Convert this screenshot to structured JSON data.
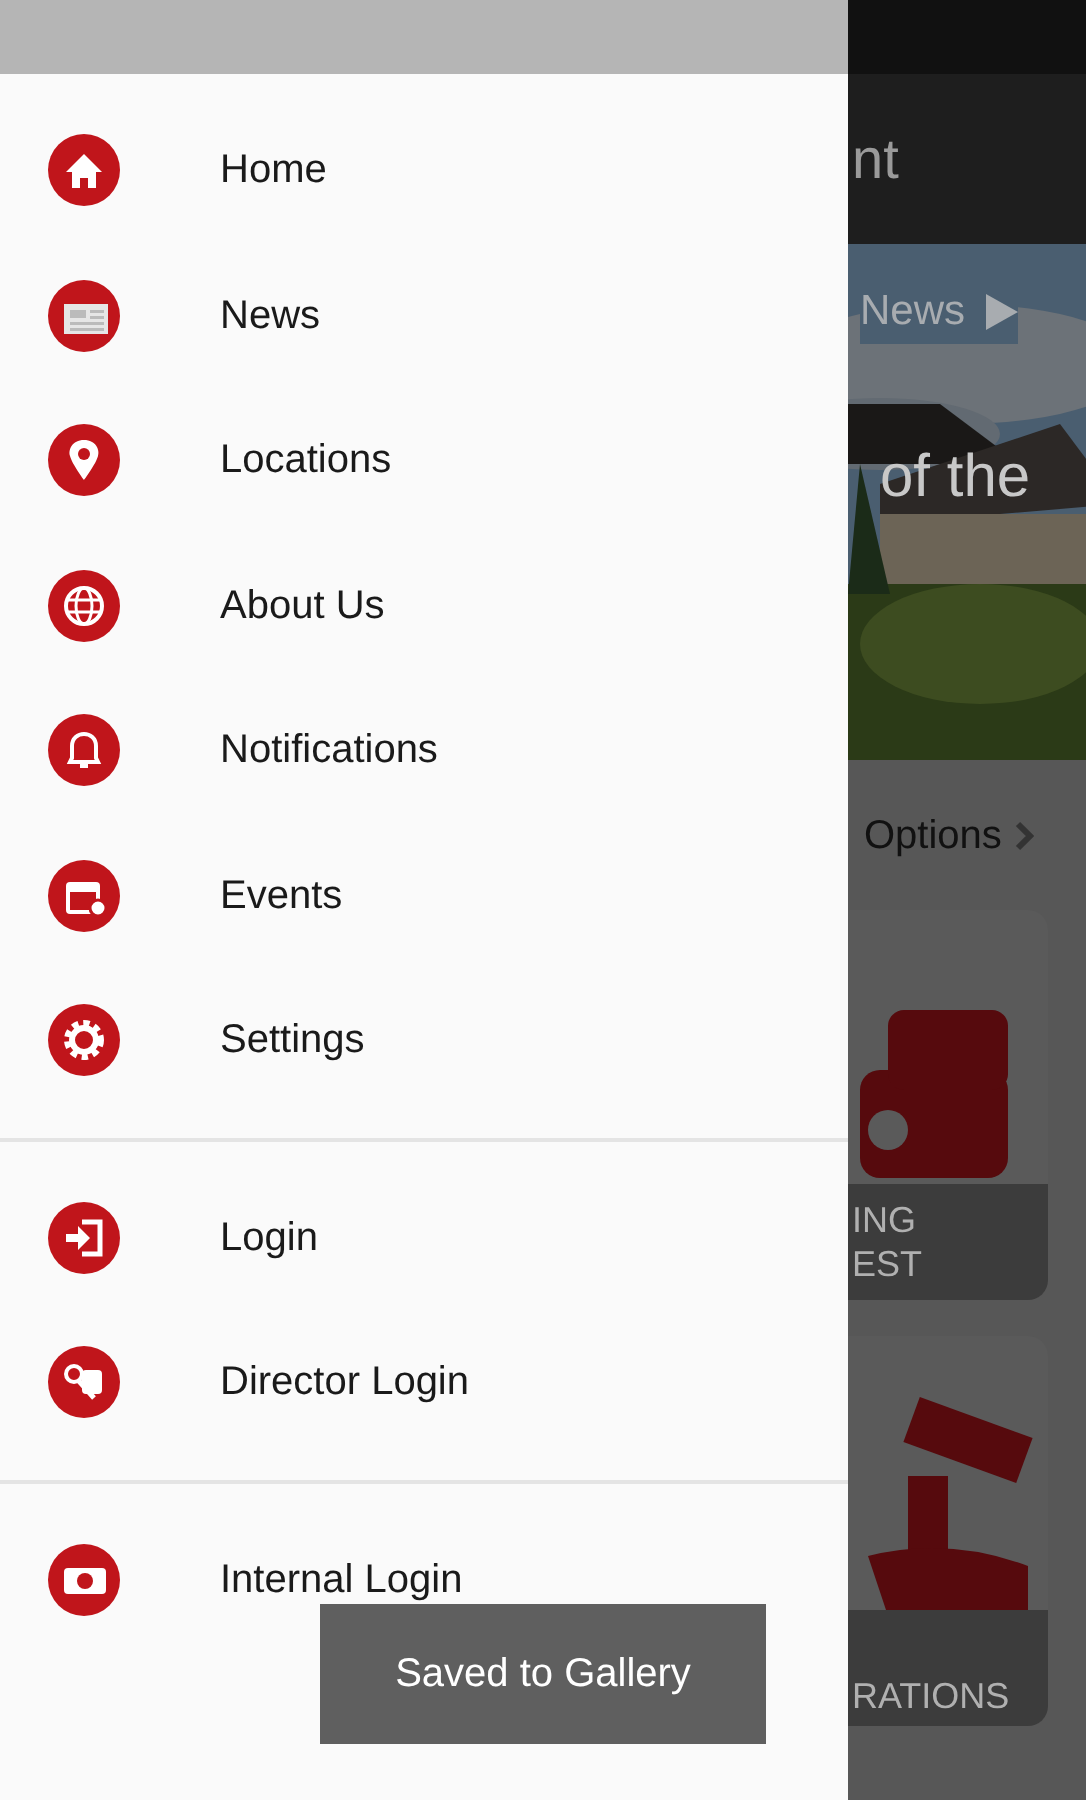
{
  "background_app": {
    "header_title": "nt",
    "news_link": "News",
    "headline": "of the",
    "section_title": "Options",
    "cards": [
      {
        "lines": [
          "ING",
          "EST"
        ]
      },
      {
        "lines": [
          "RATIONS"
        ]
      }
    ]
  },
  "drawer": {
    "groups": [
      {
        "items": [
          {
            "label": "Home"
          },
          {
            "label": "News"
          },
          {
            "label": "Locations"
          },
          {
            "label": "About Us"
          },
          {
            "label": "Notifications"
          },
          {
            "label": "Events"
          },
          {
            "label": "Settings"
          }
        ]
      },
      {
        "items": [
          {
            "label": "Login"
          },
          {
            "label": "Director Login"
          }
        ]
      },
      {
        "items": [
          {
            "label": "Internal Login"
          }
        ]
      }
    ]
  },
  "toast": "Saved to Gallery"
}
